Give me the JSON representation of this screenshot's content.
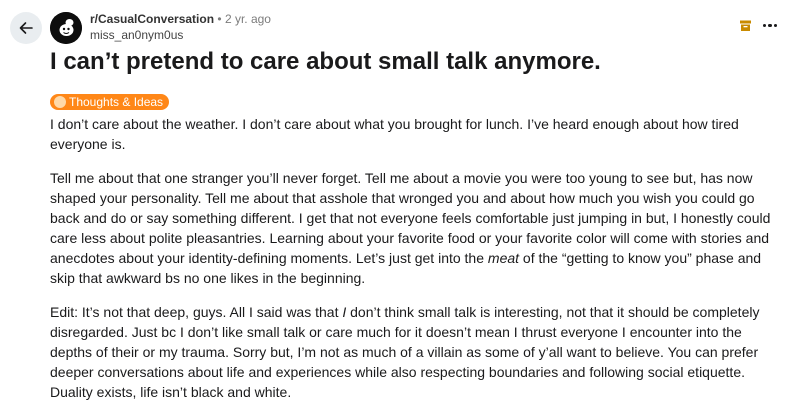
{
  "post": {
    "subreddit": "r/CasualConversation",
    "separator": "•",
    "age": "2 yr. ago",
    "author": "miss_an0nym0us",
    "title": "I can’t pretend to care about small talk anymore.",
    "flair": "Thoughts & Ideas",
    "flair_color": "#ff8717",
    "paragraph_1": "I don’t care about the weather. I don’t care about what you brought for lunch. I’ve heard enough about how tired everyone is.",
    "paragraph_2_a": "Tell me about that one stranger you’ll never forget. Tell me about a movie you were too young to see but, has now shaped your personality. Tell me about that asshole that wronged you and about how much you wish you could go back and do or say something different. I get that not everyone feels comfortable just jumping in but, I honestly could care less about polite pleasantries. Learning about your favorite food or your favorite color will come with stories and anecdotes about your identity-defining moments. Let’s just get into the ",
    "paragraph_2_em": "meat",
    "paragraph_2_b": " of the “getting to know you” phase and skip that awkward bs no one likes in the beginning.",
    "paragraph_3_a": "Edit: It’s not that deep, guys. All I said was that ",
    "paragraph_3_em": "I",
    "paragraph_3_b": " don’t think small talk is interesting, not that it should be completely disregarded. Just bc I don’t like small talk or care much for it doesn’t mean I thrust everyone I encounter into the depths of their or my trauma. Sorry but, I’m not as much of a villain as some of y’all want to believe. You can prefer deeper conversations about life and experiences while also respecting boundaries and following social etiquette. Duality exists, life isn’t black and white."
  },
  "icons": {
    "back": "arrow-left-icon",
    "archive": "archive-icon",
    "more": "more-options-icon"
  },
  "colors": {
    "archive_icon": "#c98b00",
    "back_button_bg": "#e9edf0"
  }
}
